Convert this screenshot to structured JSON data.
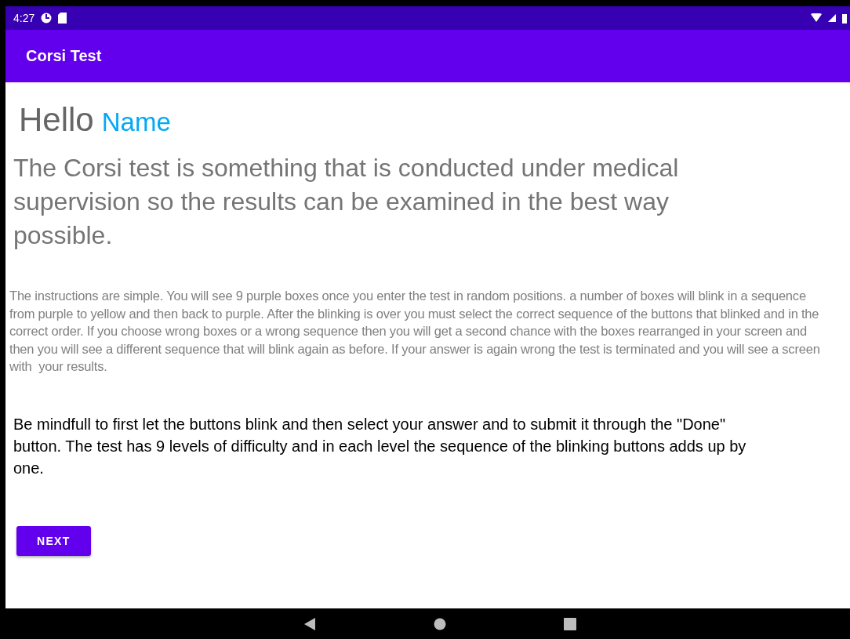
{
  "status_bar": {
    "time": "4:27"
  },
  "app_bar": {
    "title": "Corsi Test"
  },
  "greeting": {
    "hello": "Hello",
    "name": "Name"
  },
  "intro": "The Corsi test is something that is conducted under medical supervision so the results can be examined in the best way possible.",
  "instructions": "The instructions are simple. You will see 9 purple boxes once you enter the test in random positions. a number of boxes will blink in a sequence  from purple to yellow and then back to purple. After the blinking is over you must select the correct sequence of the buttons that blinked and in the correct order. If you choose wrong boxes or a wrong sequence then you will get a second chance with the boxes rearranged in your screen and then you will see a different sequence that will blink again as before. If your answer is again wrong the test is terminated and you will see a screen with  your results.",
  "note": "Be mindfull to first let the buttons blink and then select your answer and to submit it through the \"Done\" button. The test has 9 levels of difficulty and in each level the sequence of the blinking buttons adds up by one.",
  "button": "NEXT"
}
